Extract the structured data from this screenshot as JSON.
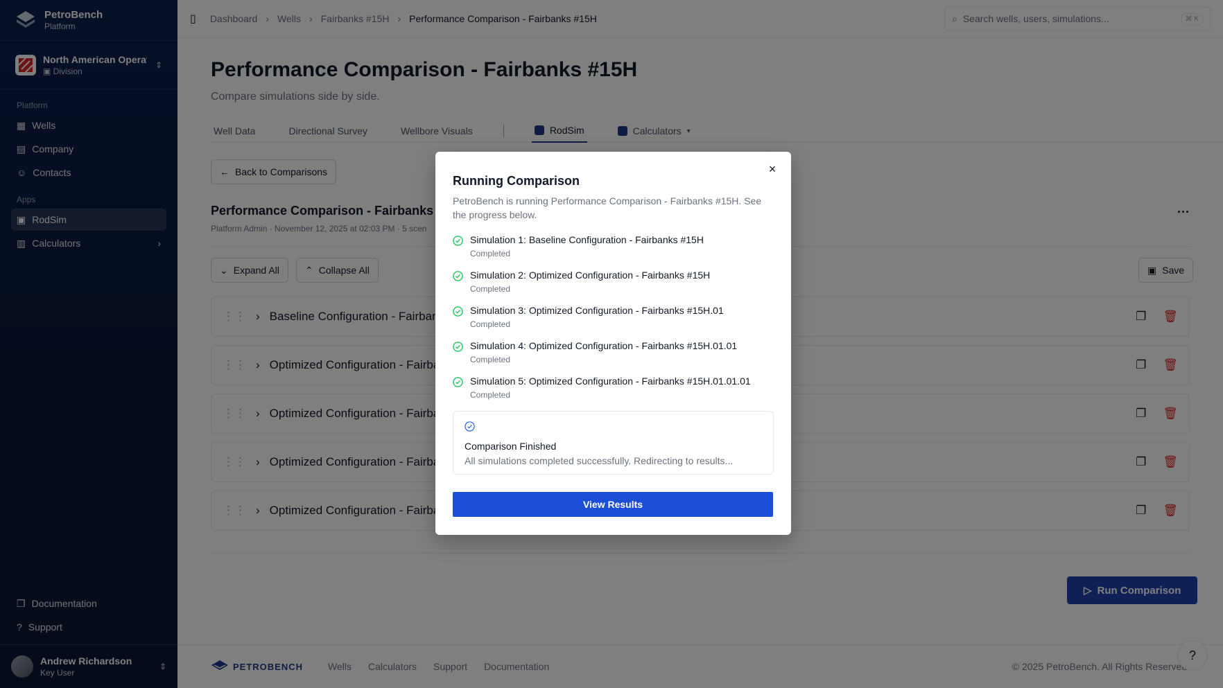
{
  "brand": {
    "name": "PetroBench",
    "sub": "Platform"
  },
  "org": {
    "name": "North American Operations",
    "type": "Division"
  },
  "sidebar": {
    "platform_label": "Platform",
    "platform_items": [
      {
        "label": "Wells",
        "icon": "wells-icon"
      },
      {
        "label": "Company",
        "icon": "building-icon"
      },
      {
        "label": "Contacts",
        "icon": "users-icon"
      }
    ],
    "apps_label": "Apps",
    "app_items": [
      {
        "label": "RodSim",
        "icon": "rodsim-icon",
        "active": true
      },
      {
        "label": "Calculators",
        "icon": "calculator-icon"
      }
    ],
    "bottom_items": [
      {
        "label": "Documentation",
        "icon": "document-icon"
      },
      {
        "label": "Support",
        "icon": "help-circle-icon"
      }
    ]
  },
  "user": {
    "name": "Andrew Richardson",
    "role": "Key User"
  },
  "topbar": {
    "breadcrumbs": [
      "Dashboard",
      "Wells",
      "Fairbanks #15H",
      "Performance Comparison - Fairbanks #15H"
    ],
    "search_placeholder": "Search wells, users, simulations...",
    "shortcut": "⌘ K"
  },
  "page": {
    "title": "Performance Comparison - Fairbanks #15H",
    "subtitle": "Compare simulations side by side."
  },
  "tabs": [
    "Well Data",
    "Directional Survey",
    "Wellbore Visuals",
    "RodSim",
    "Calculators"
  ],
  "content": {
    "back_label": "Back to Comparisons",
    "comparison_title": "Performance Comparison - Fairbanks",
    "comparison_meta": "Platform Admin · November 12, 2025 at 02:03 PM · 5 scen",
    "expand_label": "Expand All",
    "collapse_label": "Collapse All",
    "save_label": "Save",
    "rows": [
      "Baseline Configuration - Fairbank",
      "Optimized Configuration - Fairba",
      "Optimized Configuration - Fairba",
      "Optimized Configuration - Fairba",
      "Optimized Configuration - Fairba"
    ],
    "run_label": "Run Comparison"
  },
  "footer": {
    "logo_text": "PETROBENCH",
    "links": [
      "Wells",
      "Calculators",
      "Support",
      "Documentation"
    ],
    "copyright": "© 2025 PetroBench. All Rights Reserved."
  },
  "modal": {
    "title": "Running Comparison",
    "description": "PetroBench is running Performance Comparison - Fairbanks #15H. See the progress below.",
    "simulations": [
      {
        "name": "Simulation 1: Baseline Configuration - Fairbanks #15H",
        "status": "Completed"
      },
      {
        "name": "Simulation 2: Optimized Configuration - Fairbanks #15H",
        "status": "Completed"
      },
      {
        "name": "Simulation 3: Optimized Configuration - Fairbanks #15H.01",
        "status": "Completed"
      },
      {
        "name": "Simulation 4: Optimized Configuration - Fairbanks #15H.01.01",
        "status": "Completed"
      },
      {
        "name": "Simulation 5: Optimized Configuration - Fairbanks #15H.01.01.01",
        "status": "Completed"
      }
    ],
    "finished_title": "Comparison Finished",
    "finished_desc": "All simulations completed successfully. Redirecting to results...",
    "view_label": "View Results"
  },
  "colors": {
    "accent": "#1d4ed8",
    "success": "#22c55e",
    "danger": "#dc2626",
    "sidebar": "#0b1f4d"
  }
}
